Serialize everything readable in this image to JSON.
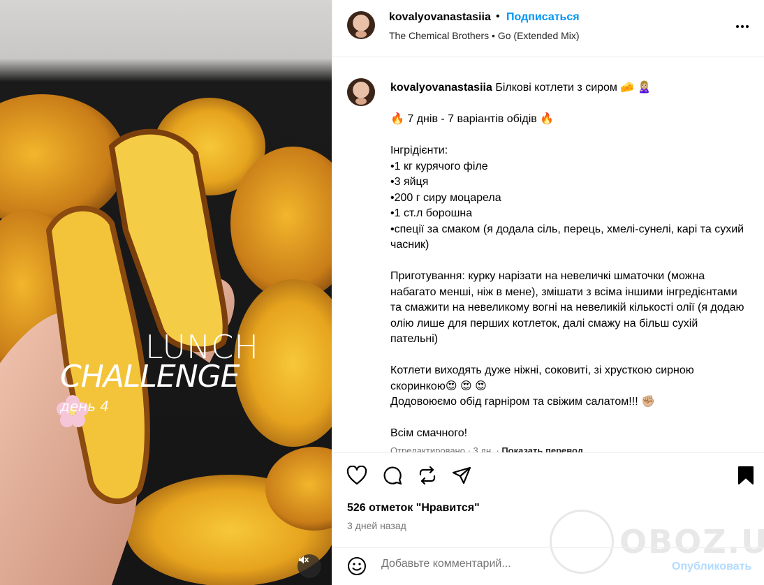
{
  "post": {
    "overlay": {
      "line1": "LUNCH",
      "line2": "CHALLENGE",
      "line3": "день 4"
    }
  },
  "header": {
    "username": "kovalyovanastasiia",
    "separator": "•",
    "follow_label": "Подписаться",
    "audio": "The Chemical Brothers • Go (Extended Mix)"
  },
  "caption": {
    "username": "kovalyovanastasiia",
    "title": "Білкові котлети з сиром 🧀 🙎🏼‍♀️",
    "subtitle": "🔥 7 днів - 7 варіантів обідів 🔥",
    "ingredients_heading": "Інгрідієнти:",
    "ingredients": [
      "•1 кг курячого філе",
      "•3 яйця",
      "•200 г сиру моцарела",
      "•1 ст.л борошна",
      "•спеції за смаком (я додала сіль, перець, хмелі-сунелі, карі та сухий часник)"
    ],
    "preparation": "Приготування: курку нарізати на невеличкі шматочки (можна набагато менші, ніж в мене), змішати з всіма іншими інгрeдієнтами та смажити на невеликому вогні на невеликій кількості олії (я додаю олію лише для перших котлеток, далі смажу на більш сухій пательні)",
    "result_line1": "Котлети виходять дуже ніжні, соковиті, зі хрусткою сирною скоринкою😍 😍 😍",
    "result_line2": "Додовоюємо обід гарніром та свіжим салатом!!! ✊🏼",
    "closing": "Всім смачного!",
    "meta_edited": "Отредактировано · 3 дн.",
    "meta_translate": "Показать перевод"
  },
  "engagement": {
    "likes": "526 отметок \"Нравится\"",
    "posted": "3 дней назад"
  },
  "comment": {
    "placeholder": "Добавьте комментарий...",
    "post_label": "Опубликовать"
  },
  "watermark": {
    "text": "OBOZ.UA"
  },
  "colors": {
    "accent": "#0095f6",
    "post_disabled": "#b3dbff",
    "muted": "#737373",
    "divider": "#efefef"
  }
}
